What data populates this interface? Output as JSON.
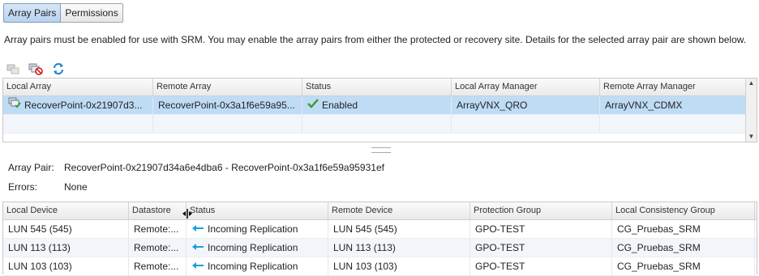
{
  "tabs": [
    {
      "label": "Array Pairs",
      "active": true
    },
    {
      "label": "Permissions",
      "active": false
    }
  ],
  "description": "Array pairs must be enabled for use with SRM. You may enable the array pairs from either the protected or recovery site. Details for the selected array pair are shown below.",
  "toolbar": {
    "icons": [
      "enable-array-pair-icon",
      "disable-array-pair-icon",
      "refresh-icon"
    ]
  },
  "array_pairs": {
    "columns": [
      "Local Array",
      "Remote Array",
      "Status",
      "Local Array Manager",
      "Remote Array Manager"
    ],
    "rows": [
      {
        "local_array": "RecoverPoint-0x21907d3...",
        "remote_array": "RecoverPoint-0x3a1f6e59a95...",
        "status": "Enabled",
        "local_manager": "ArrayVNX_QRO",
        "remote_manager": "ArrayVNX_CDMX"
      }
    ]
  },
  "details": {
    "array_pair_label": "Array Pair:",
    "array_pair_value": "RecoverPoint-0x21907d34a6e4dba6 - RecoverPoint-0x3a1f6e59a95931ef",
    "errors_label": "Errors:",
    "errors_value": "None"
  },
  "devices": {
    "columns": [
      "Local Device",
      "Datastore",
      "Status",
      "Remote Device",
      "Protection Group",
      "Local Consistency Group"
    ],
    "rows": [
      {
        "local_device": "LUN 545 (545)",
        "datastore": "Remote:...",
        "status": "Incoming Replication",
        "remote_device": "LUN 545 (545)",
        "protection_group": "GPO-TEST",
        "consistency_group": "CG_Pruebas_SRM"
      },
      {
        "local_device": "LUN 113 (113)",
        "datastore": "Remote:...",
        "status": "Incoming Replication",
        "remote_device": "LUN 113 (113)",
        "protection_group": "GPO-TEST",
        "consistency_group": "CG_Pruebas_SRM"
      },
      {
        "local_device": "LUN 103 (103)",
        "datastore": "Remote:...",
        "status": "Incoming Replication",
        "remote_device": "LUN 103 (103)",
        "protection_group": "GPO-TEST",
        "consistency_group": "CG_Pruebas_SRM"
      }
    ]
  },
  "colors": {
    "selection": "#bfdcf5",
    "enabled_check": "#3a9b2a",
    "incoming_arrow": "#1aa0e0"
  }
}
